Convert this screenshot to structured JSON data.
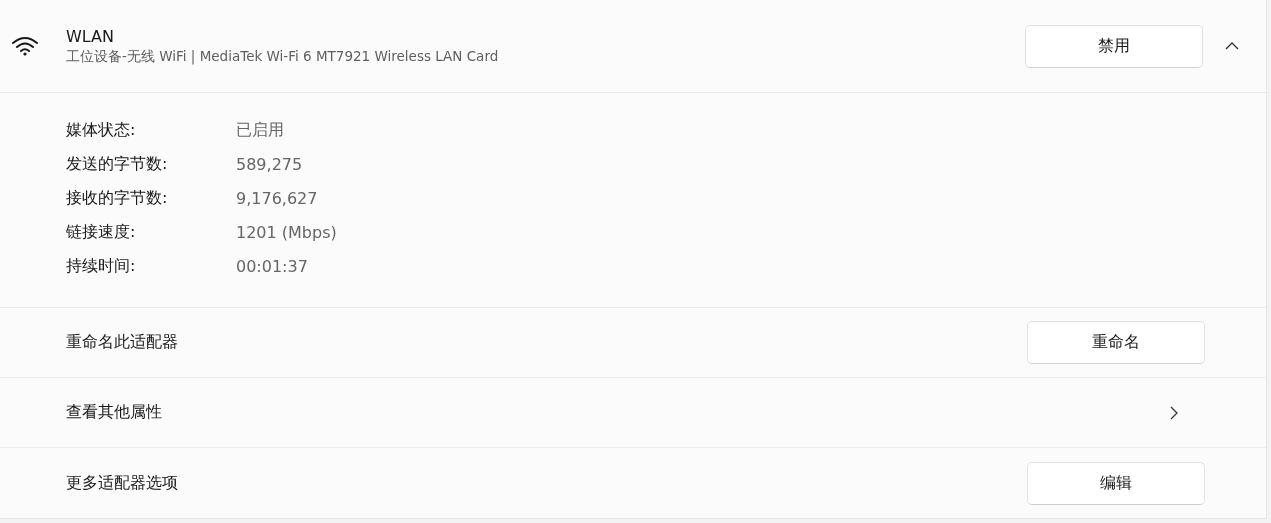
{
  "adapter": {
    "name": "WLAN",
    "description": "工位设备-无线 WiFi | MediaTek Wi-Fi 6 MT7921 Wireless LAN Card",
    "button": "禁用",
    "expanded": true
  },
  "details": [
    {
      "label": "媒体状态:",
      "value": "已启用"
    },
    {
      "label": "发送的字节数:",
      "value": "589,275"
    },
    {
      "label": "接收的字节数:",
      "value": "9,176,627"
    },
    {
      "label": "链接速度:",
      "value": "1201 (Mbps)"
    },
    {
      "label": "持续时间:",
      "value": "00:01:37"
    }
  ],
  "rows": [
    {
      "kind": "button",
      "label": "重命名此适配器",
      "button": "重命名"
    },
    {
      "kind": "link",
      "label": "查看其他属性"
    },
    {
      "kind": "button",
      "label": "更多适配器选项",
      "button": "编辑"
    }
  ]
}
